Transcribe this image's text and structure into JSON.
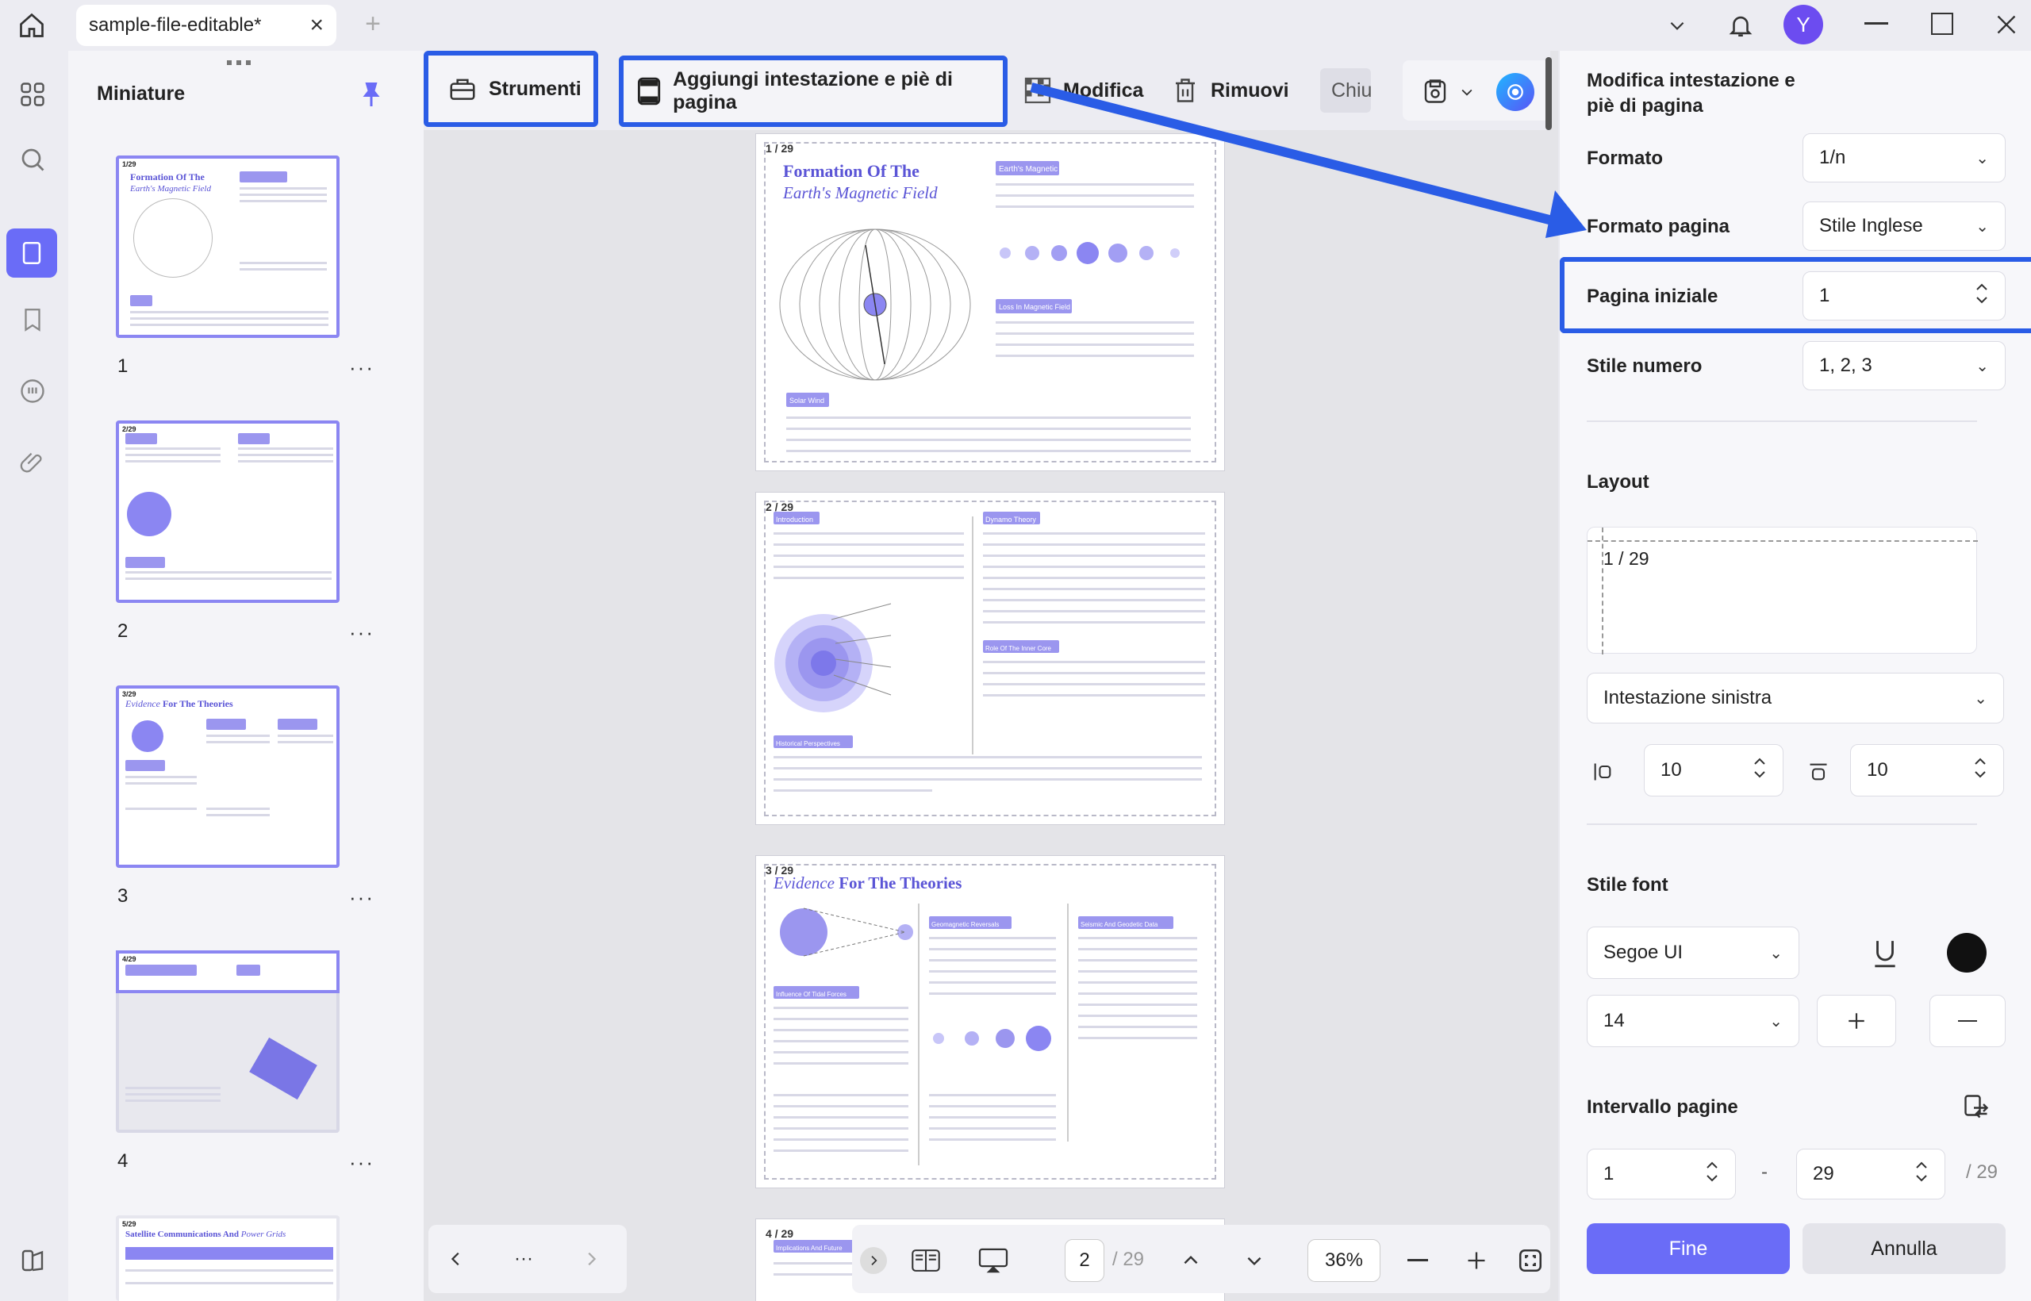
{
  "titlebar": {
    "tab_title": "sample-file-editable*",
    "close_glyph": "×",
    "new_tab_glyph": "+",
    "avatar_letter": "Y"
  },
  "thumbnails": {
    "title": "Miniature",
    "items": [
      {
        "number": "1",
        "header": "1/29",
        "title_a": "Formation Of The",
        "title_b": "Earth's Magnetic Field"
      },
      {
        "number": "2",
        "header": "2/29"
      },
      {
        "number": "3",
        "header": "3/29",
        "title_a": "Evidence",
        "title_b": "For The Theories"
      },
      {
        "number": "4",
        "header": "4/29"
      },
      {
        "number": "5",
        "header": "5/29",
        "title_a": "Satellite Communications And",
        "title_b": "Power Grids"
      }
    ],
    "more_glyph": "···"
  },
  "toolbar": {
    "tools_label": "Strumenti",
    "header_footer_label": "Aggiungi intestazione e piè di pagina",
    "edit_label": "Modifica",
    "remove_label": "Rimuovi",
    "close_label": "Chiu"
  },
  "pages": [
    {
      "header": "1 / 29",
      "title_a": "Formation Of The",
      "title_b": "Earth's Magnetic Field",
      "section_a": "Earth's Magnetic",
      "section_b": "Loss In Magnetic Field",
      "section_c": "Solar Wind"
    },
    {
      "header": "2 / 29",
      "section_a": "Introduction",
      "section_b": "Dynamo Theory",
      "section_c": "Role Of The Inner Core",
      "section_d": "Historical Perspectives"
    },
    {
      "header": "3 / 29",
      "title_a": "Evidence",
      "title_b": "For The Theories",
      "section_a": "Geomagnetic Reversals",
      "section_b": "Seismic And Geodetic Data",
      "section_c": "Influence Of Tidal Forces"
    },
    {
      "header": "4 / 29",
      "section_a": "Implications And Future"
    }
  ],
  "bottombar": {
    "page_current": "2",
    "page_total": "/ 29",
    "zoom": "36%",
    "more": "···"
  },
  "panel": {
    "title": "Modifica intestazione e piè di pagina",
    "format_label": "Formato",
    "format_value": "1/n",
    "page_format_label": "Formato pagina",
    "page_format_value": "Stile Inglese",
    "start_page_label": "Pagina iniziale",
    "start_page_value": "1",
    "number_style_label": "Stile numero",
    "number_style_value": "1, 2, 3",
    "layout_label": "Layout",
    "layout_preview": "1 / 29",
    "position_value": "Intestazione sinistra",
    "margin_left": "10",
    "margin_top": "10",
    "font_style_label": "Stile font",
    "font_value": "Segoe UI",
    "font_size": "14",
    "font_color": "#111111",
    "range_label": "Intervallo pagine",
    "range_from": "1",
    "range_dash": "-",
    "range_to": "29",
    "range_total": "/ 29",
    "done_label": "Fine",
    "cancel_label": "Annulla"
  },
  "colors": {
    "accent": "#6a6cf7",
    "highlight": "#2a5ce6",
    "purple": "#5a54d6"
  }
}
